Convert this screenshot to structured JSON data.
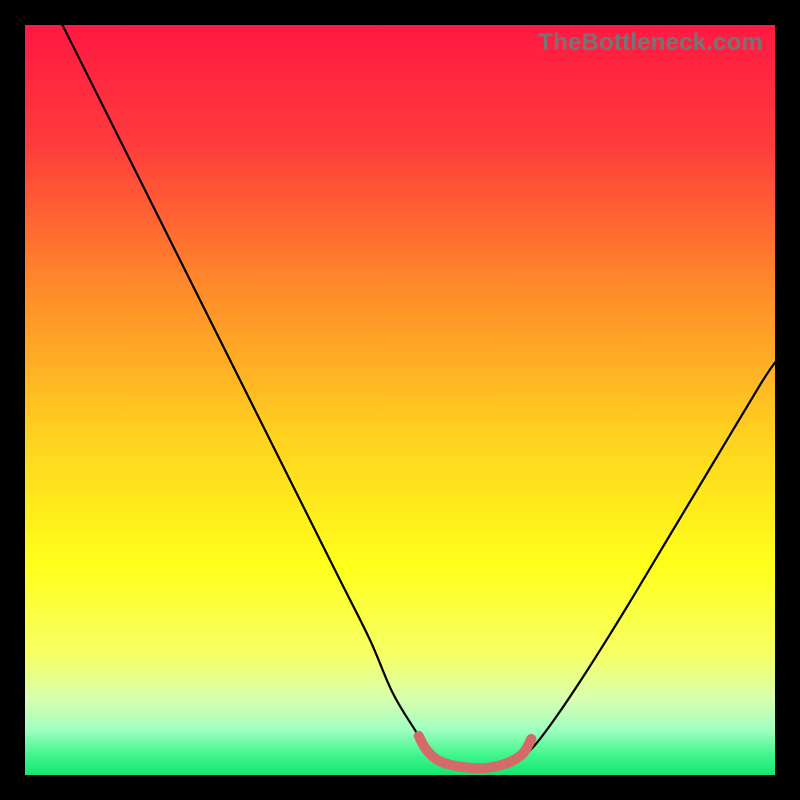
{
  "watermark": "TheBottleneck.com",
  "chart_data": {
    "type": "line",
    "title": "",
    "xlabel": "",
    "ylabel": "",
    "xlim": [
      0,
      100
    ],
    "ylim": [
      0,
      100
    ],
    "gradient_stops": [
      {
        "offset": 0.0,
        "color": "#ff1942"
      },
      {
        "offset": 0.16,
        "color": "#ff3c3c"
      },
      {
        "offset": 0.35,
        "color": "#ff8a2a"
      },
      {
        "offset": 0.55,
        "color": "#ffd21f"
      },
      {
        "offset": 0.72,
        "color": "#ffff1a"
      },
      {
        "offset": 0.84,
        "color": "#f6ff66"
      },
      {
        "offset": 0.9,
        "color": "#d6ffb0"
      },
      {
        "offset": 0.94,
        "color": "#9effc0"
      },
      {
        "offset": 0.975,
        "color": "#3cf58a"
      },
      {
        "offset": 1.0,
        "color": "#14e56f"
      }
    ],
    "series": [
      {
        "name": "bottleneck-curve",
        "color": "#000000",
        "width": 2.2,
        "points": [
          {
            "x": 5,
            "y": 100
          },
          {
            "x": 8,
            "y": 94
          },
          {
            "x": 13,
            "y": 84
          },
          {
            "x": 19,
            "y": 72
          },
          {
            "x": 25,
            "y": 60
          },
          {
            "x": 31,
            "y": 48
          },
          {
            "x": 37,
            "y": 36
          },
          {
            "x": 42,
            "y": 26
          },
          {
            "x": 46,
            "y": 18
          },
          {
            "x": 49,
            "y": 11
          },
          {
            "x": 52,
            "y": 6
          },
          {
            "x": 54,
            "y": 3
          },
          {
            "x": 56,
            "y": 1.4
          },
          {
            "x": 58,
            "y": 0.9
          },
          {
            "x": 61,
            "y": 0.8
          },
          {
            "x": 64,
            "y": 1.1
          },
          {
            "x": 66,
            "y": 2.2
          },
          {
            "x": 68,
            "y": 4
          },
          {
            "x": 71,
            "y": 8
          },
          {
            "x": 75,
            "y": 14
          },
          {
            "x": 80,
            "y": 22
          },
          {
            "x": 86,
            "y": 32
          },
          {
            "x": 92,
            "y": 42
          },
          {
            "x": 98,
            "y": 52
          },
          {
            "x": 100,
            "y": 55
          }
        ]
      },
      {
        "name": "optimal-band",
        "color": "#d46a6a",
        "width": 10,
        "points": [
          {
            "x": 52.5,
            "y": 5.2
          },
          {
            "x": 53.5,
            "y": 3.4
          },
          {
            "x": 55,
            "y": 2.0
          },
          {
            "x": 57,
            "y": 1.3
          },
          {
            "x": 59,
            "y": 1.0
          },
          {
            "x": 61,
            "y": 0.9
          },
          {
            "x": 63,
            "y": 1.2
          },
          {
            "x": 65,
            "y": 1.9
          },
          {
            "x": 66.5,
            "y": 3.0
          },
          {
            "x": 67.5,
            "y": 4.8
          }
        ]
      }
    ]
  }
}
